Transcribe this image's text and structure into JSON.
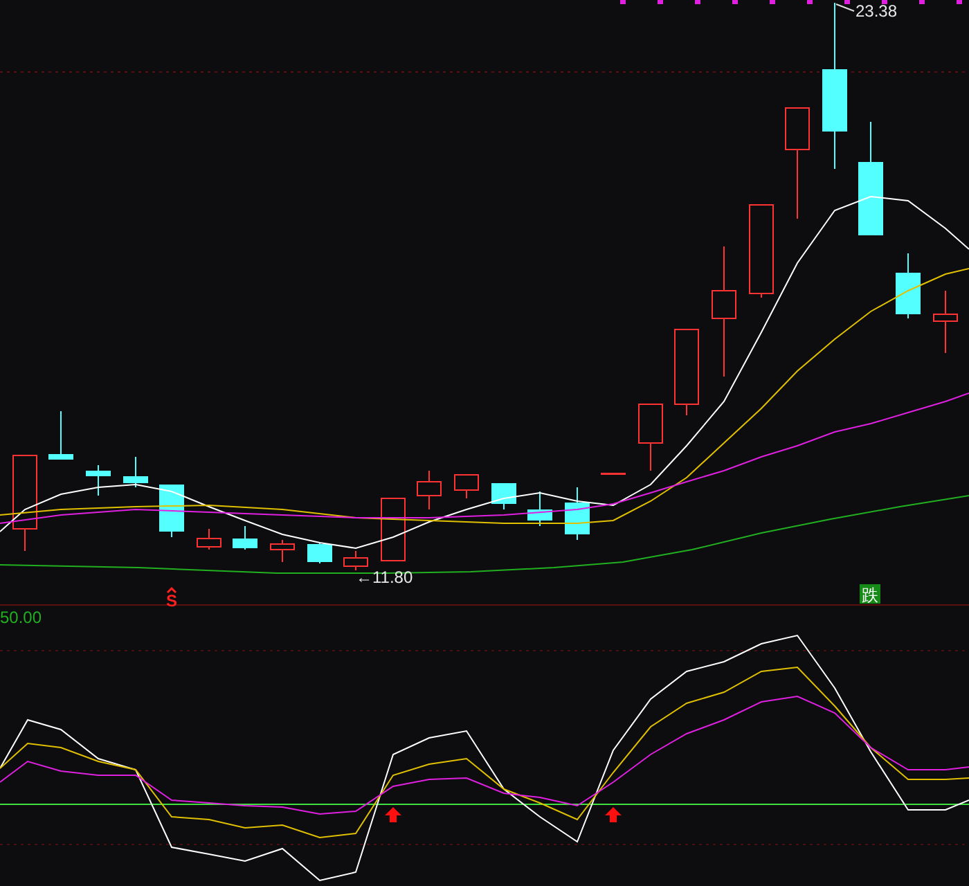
{
  "price_panel": {
    "high_label": "23.38",
    "low_label": "←11.80",
    "signals": [
      {
        "kind": "sell",
        "text": "S"
      },
      {
        "kind": "fall",
        "text": "跌"
      }
    ]
  },
  "indicator_panel": {
    "axis_label": "50.00"
  }
}
